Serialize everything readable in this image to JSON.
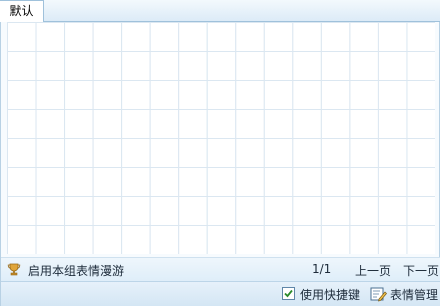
{
  "tabs": [
    {
      "label": "默认",
      "selected": true
    }
  ],
  "emoticon_grid": {
    "columns": 15,
    "rows": 8,
    "line_color": "#dbe7f1"
  },
  "roam": {
    "icon": "trophy-icon",
    "label": "启用本组表情漫游"
  },
  "pagination": {
    "current": "1/1",
    "prev_label": "上一页",
    "next_label": "下一页"
  },
  "toolbar": {
    "shortcut_label": "使用快捷键",
    "shortcut_checked": true,
    "manage_icon": "edit-emoticon-icon",
    "manage_label": "表情管理"
  }
}
